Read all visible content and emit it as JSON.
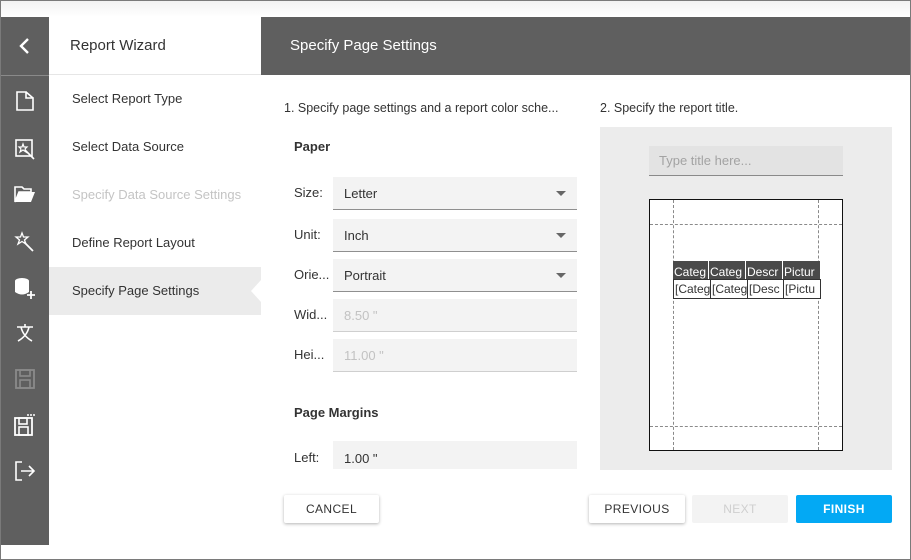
{
  "wizard": {
    "title": "Report Wizard",
    "header_title": "Specify Page Settings"
  },
  "iconbar": {
    "back_icon": "chevron-left-icon",
    "icons": [
      "new-report-icon",
      "report-wizard-icon",
      "open-folder-icon",
      "magic-wand-icon",
      "add-data-source-icon",
      "localization-icon",
      "save-icon-disabled",
      "save-as-icon",
      "exit-icon"
    ]
  },
  "nav": {
    "items": [
      {
        "label": "Select Report Type",
        "state": "normal"
      },
      {
        "label": "Select Data Source",
        "state": "normal"
      },
      {
        "label": "Specify Data Source Settings",
        "state": "disabled"
      },
      {
        "label": "Define Report Layout",
        "state": "normal"
      },
      {
        "label": "Specify Page Settings",
        "state": "active"
      }
    ]
  },
  "settings": {
    "caption": "1. Specify page settings and a report color sche...",
    "paper_group": "Paper",
    "size_label": "Size:",
    "size_value": "Letter",
    "unit_label": "Unit:",
    "unit_value": "Inch",
    "orientation_label": "Orie...",
    "orientation_value": "Portrait",
    "width_label": "Wid...",
    "width_value": "8.50 \"",
    "height_label": "Hei...",
    "height_value": "11.00 \"",
    "margins_group": "Page Margins",
    "left_label": "Left:",
    "left_value": "1.00 \""
  },
  "title_section": {
    "caption": "2. Specify the report title.",
    "placeholder": "Type title here...",
    "table_headers": [
      "Categ",
      "Categ",
      "Descr",
      "Pictur"
    ],
    "table_cells": [
      "[Categ",
      "[Categ",
      "[Desc",
      "[Pictu"
    ]
  },
  "buttons": {
    "cancel": "CANCEL",
    "previous": "PREVIOUS",
    "next": "NEXT",
    "finish": "FINISH"
  },
  "colors": {
    "accent": "#03a9f4",
    "sidebar": "#5f5f5f",
    "header": "#5f5f5f"
  }
}
